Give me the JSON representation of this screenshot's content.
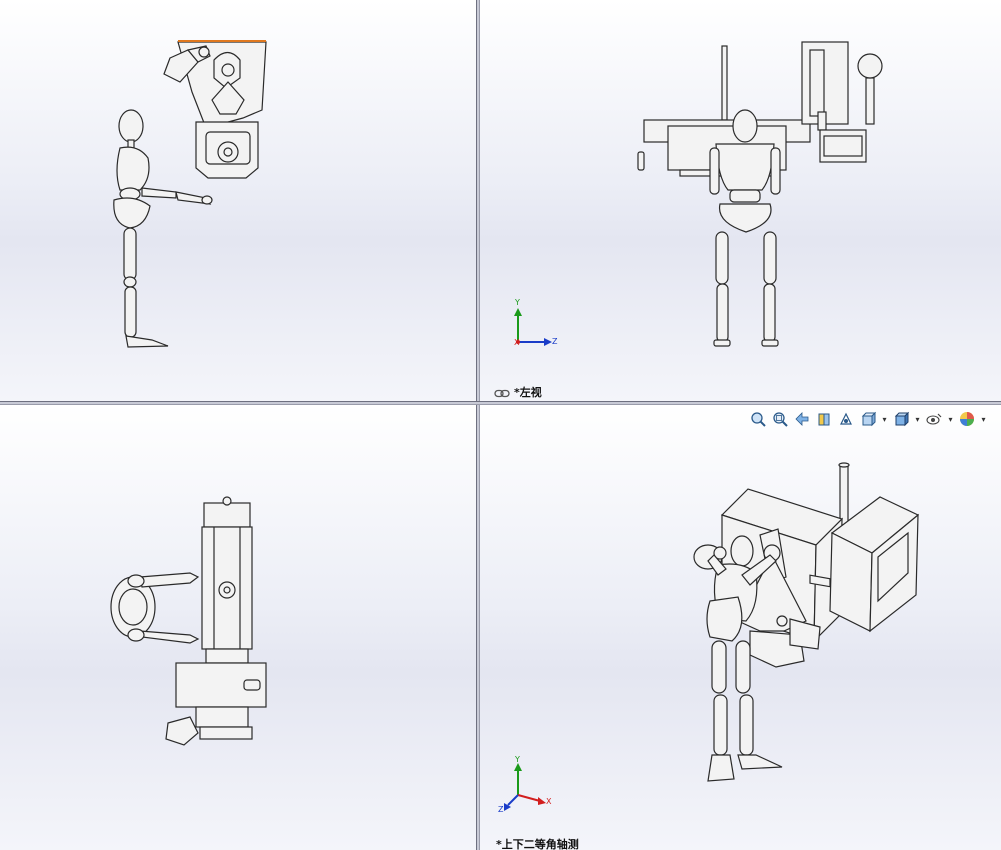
{
  "viewports": {
    "top_left": {
      "label": ""
    },
    "top_right": {
      "label": "*左视",
      "triad": {
        "y": "Y",
        "x": "X",
        "z": "Z"
      }
    },
    "bottom_left": {
      "label": ""
    },
    "bottom_right": {
      "label": "*上下二等角轴测",
      "triad": {
        "y": "Y",
        "x": "X",
        "z": "Z"
      }
    }
  },
  "heads_up_toolbar": {
    "buttons": [
      {
        "icon": "zoom-to-fit-icon"
      },
      {
        "icon": "zoom-to-area-icon"
      },
      {
        "icon": "previous-view-icon"
      },
      {
        "icon": "section-view-icon"
      },
      {
        "icon": "dynamic-annotation-icon"
      },
      {
        "icon": "view-orientation-icon",
        "has_dropdown": true
      },
      {
        "icon": "display-style-icon",
        "has_dropdown": true
      },
      {
        "icon": "hide-show-items-icon",
        "has_dropdown": true
      },
      {
        "icon": "edit-appearance-icon",
        "has_dropdown": true
      }
    ]
  },
  "colors": {
    "axis_x": "#d21e1e",
    "axis_y": "#1a9a1a",
    "axis_z": "#1a3cc8",
    "highlight_edge": "#e0781e",
    "model_fill": "#f3f3f3",
    "model_line": "#2a2a2a"
  }
}
